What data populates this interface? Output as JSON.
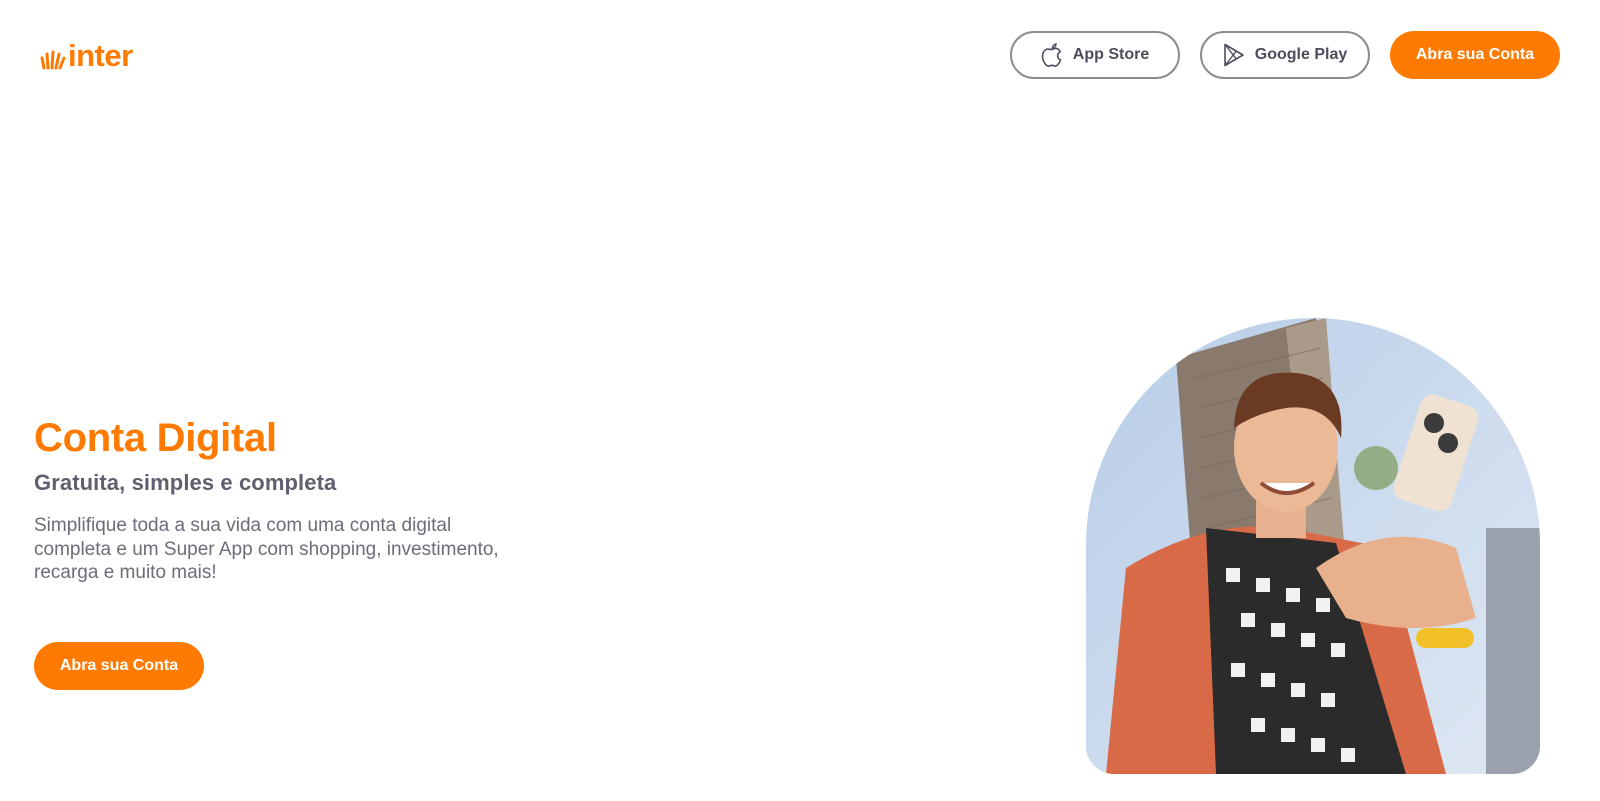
{
  "header": {
    "logo_text": "inter",
    "nav": {
      "app_store_label": "App Store",
      "google_play_label": "Google Play",
      "cta_label": "Abra sua Conta"
    }
  },
  "hero": {
    "title": "Conta Digital",
    "subtitle": "Gratuita, simples e completa",
    "description": "Simplifique toda a sua vida com uma conta digital completa e um Super App com shopping, investimento, recarga e muito mais!",
    "cta_label": "Abra sua Conta"
  },
  "icons": {
    "logo": "inter-sunburst-logo",
    "app_store": "apple-icon",
    "google_play": "play-store-icon"
  },
  "colors": {
    "brand_orange": "#ff7a00",
    "text_gray": "#5e6070",
    "border_gray": "#8c8c94"
  }
}
